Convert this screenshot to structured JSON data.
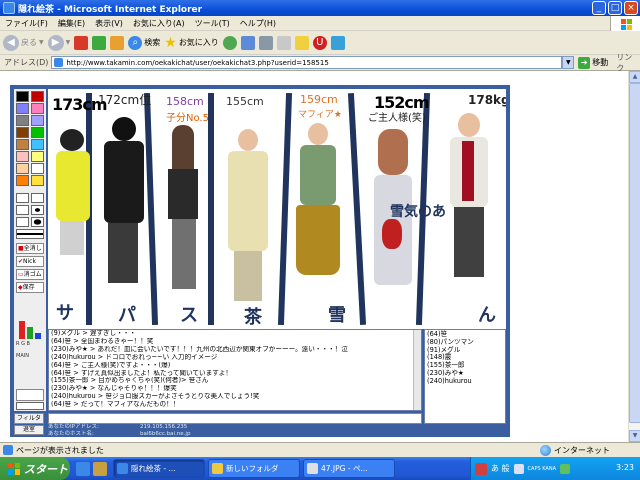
{
  "window": {
    "title": "隠れ絵茶 - Microsoft Internet Explorer"
  },
  "menu": [
    "ファイル(F)",
    "編集(E)",
    "表示(V)",
    "お気に入り(A)",
    "ツール(T)",
    "ヘルプ(H)"
  ],
  "toolbar": {
    "back": "戻る",
    "search": "検索",
    "favorites": "お気に入り"
  },
  "address": {
    "label": "アドレス(D)",
    "url": "http://www.takamin.com/oekakichat/user/oekakichat3.php?userid=158515",
    "go": "移動",
    "links": "リンク"
  },
  "drawing": {
    "height_labels": [
      "173cm",
      "172cm位",
      "158cm",
      "155cm",
      "159cm",
      "152cm",
      "178kg"
    ],
    "captions": [
      "子分No.5",
      "マフィア★",
      "ご主人様(笑)",
      "雪気のあ"
    ],
    "bottom_scribbles": [
      "サ",
      "パ",
      "ス",
      "茶",
      "雪",
      "ん"
    ]
  },
  "palette": {
    "colors": [
      "#000000",
      "#c00000",
      "#8080ff",
      "#ff80c0",
      "#808080",
      "#a0a0ff",
      "#804000",
      "#00c000",
      "#c08040",
      "#40c0ff",
      "#ffc0c0",
      "#ffff80",
      "#ffd0a0",
      "#ffffff",
      "#ff8000",
      "#ffe040"
    ],
    "tools": [
      "全消し",
      "Nick",
      "消ゴム",
      "保存"
    ],
    "rgb_label": "R G B",
    "mode_label": "MAIN"
  },
  "chat": {
    "lines": [
      "(9)メグル > 遅すぎし・・・",
      "(64)笹 > 全国まわるきゃー！！笑",
      "(230)みや★ > あれだ！皿に会いたいです！！！九州の北西辺か関東オフかーーー。遠い・・・！泣",
      "(240)hukurou > ドコロでおれっ~~い 入力的イメージ",
      "(64)笹 > ご主人様(笑)ですよ・・・(爆)",
      "(64)笹 > すげえ真似出ましたよ！私たって聞いていますよ！",
      "(155)茶一郎 > 目がめちゃくちゃ(笑)(何者)> 笹さん",
      "(230)みや★ > なんじゃそりゃ！！！爆笑",
      "(240)hukurou > 笹ジョロ服スカーがよさそうとりな美人でしょう!笑",
      "(64)笹 > だって！マフィアなんだもの！！"
    ]
  },
  "users": [
    "(64)笹",
    "(80)パンツマン",
    "(91)メグル",
    "(148)霰",
    "(155)茶一郎",
    "(230)みや★",
    "(240)hukurou"
  ],
  "controls": {
    "filter": "フィルタ",
    "exit": "退室"
  },
  "ipinfo": {
    "ip_label": "あなたのIPアドレス:",
    "ip_value": "219.105.156.235",
    "host_label": "あなたのホスト名:",
    "host_value": "bal6b6cc.bai.ne.jp"
  },
  "status": {
    "text": "ページが表示されました",
    "zone": "インターネット"
  },
  "taskbar": {
    "start": "スタート",
    "tasks": [
      "隠れ絵茶 - ...",
      "新しいフォルダ",
      "47.JPG - ペ..."
    ],
    "ime": "あ 般",
    "caps": "CAPS KANA",
    "clock": "3:23"
  }
}
